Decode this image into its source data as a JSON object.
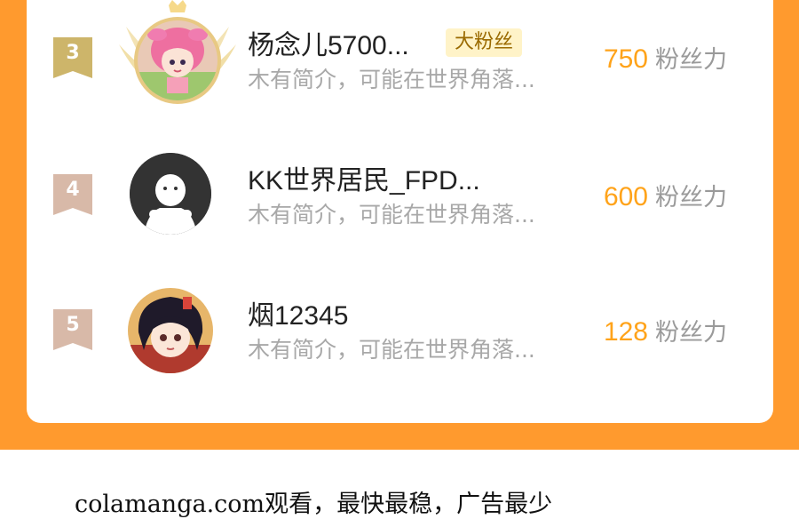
{
  "colors": {
    "background_orange": "#FF9A2E",
    "card": "#FFFFFF",
    "score": "#FFA31A",
    "rank_gold": "#CDB56A",
    "rank_bronze": "#D8B9A8",
    "fan_badge_bg": "#FFF3C8",
    "fan_badge_text": "#9A6A00"
  },
  "ranking": [
    {
      "rank": "3",
      "name": "杨念儿5700...",
      "badge": "大粉丝",
      "bio": "木有简介，可能在世界角落...",
      "score": "750",
      "score_unit": "粉丝力",
      "avatar": "anime-girl-pink-hair-avatar",
      "frame": "gold-crown-wings-frame"
    },
    {
      "rank": "4",
      "name": "KK世界居民_FPD...",
      "bio": "木有简介，可能在世界角落...",
      "score": "600",
      "score_unit": "粉丝力",
      "avatar": "default-user-avatar"
    },
    {
      "rank": "5",
      "name": "烟12345",
      "bio": "木有简介，可能在世界角落...",
      "score": "128",
      "score_unit": "粉丝力",
      "avatar": "anime-boy-dark-hair-avatar"
    }
  ],
  "footer": {
    "text": "colamanga.com观看，最快最稳，广告最少"
  }
}
